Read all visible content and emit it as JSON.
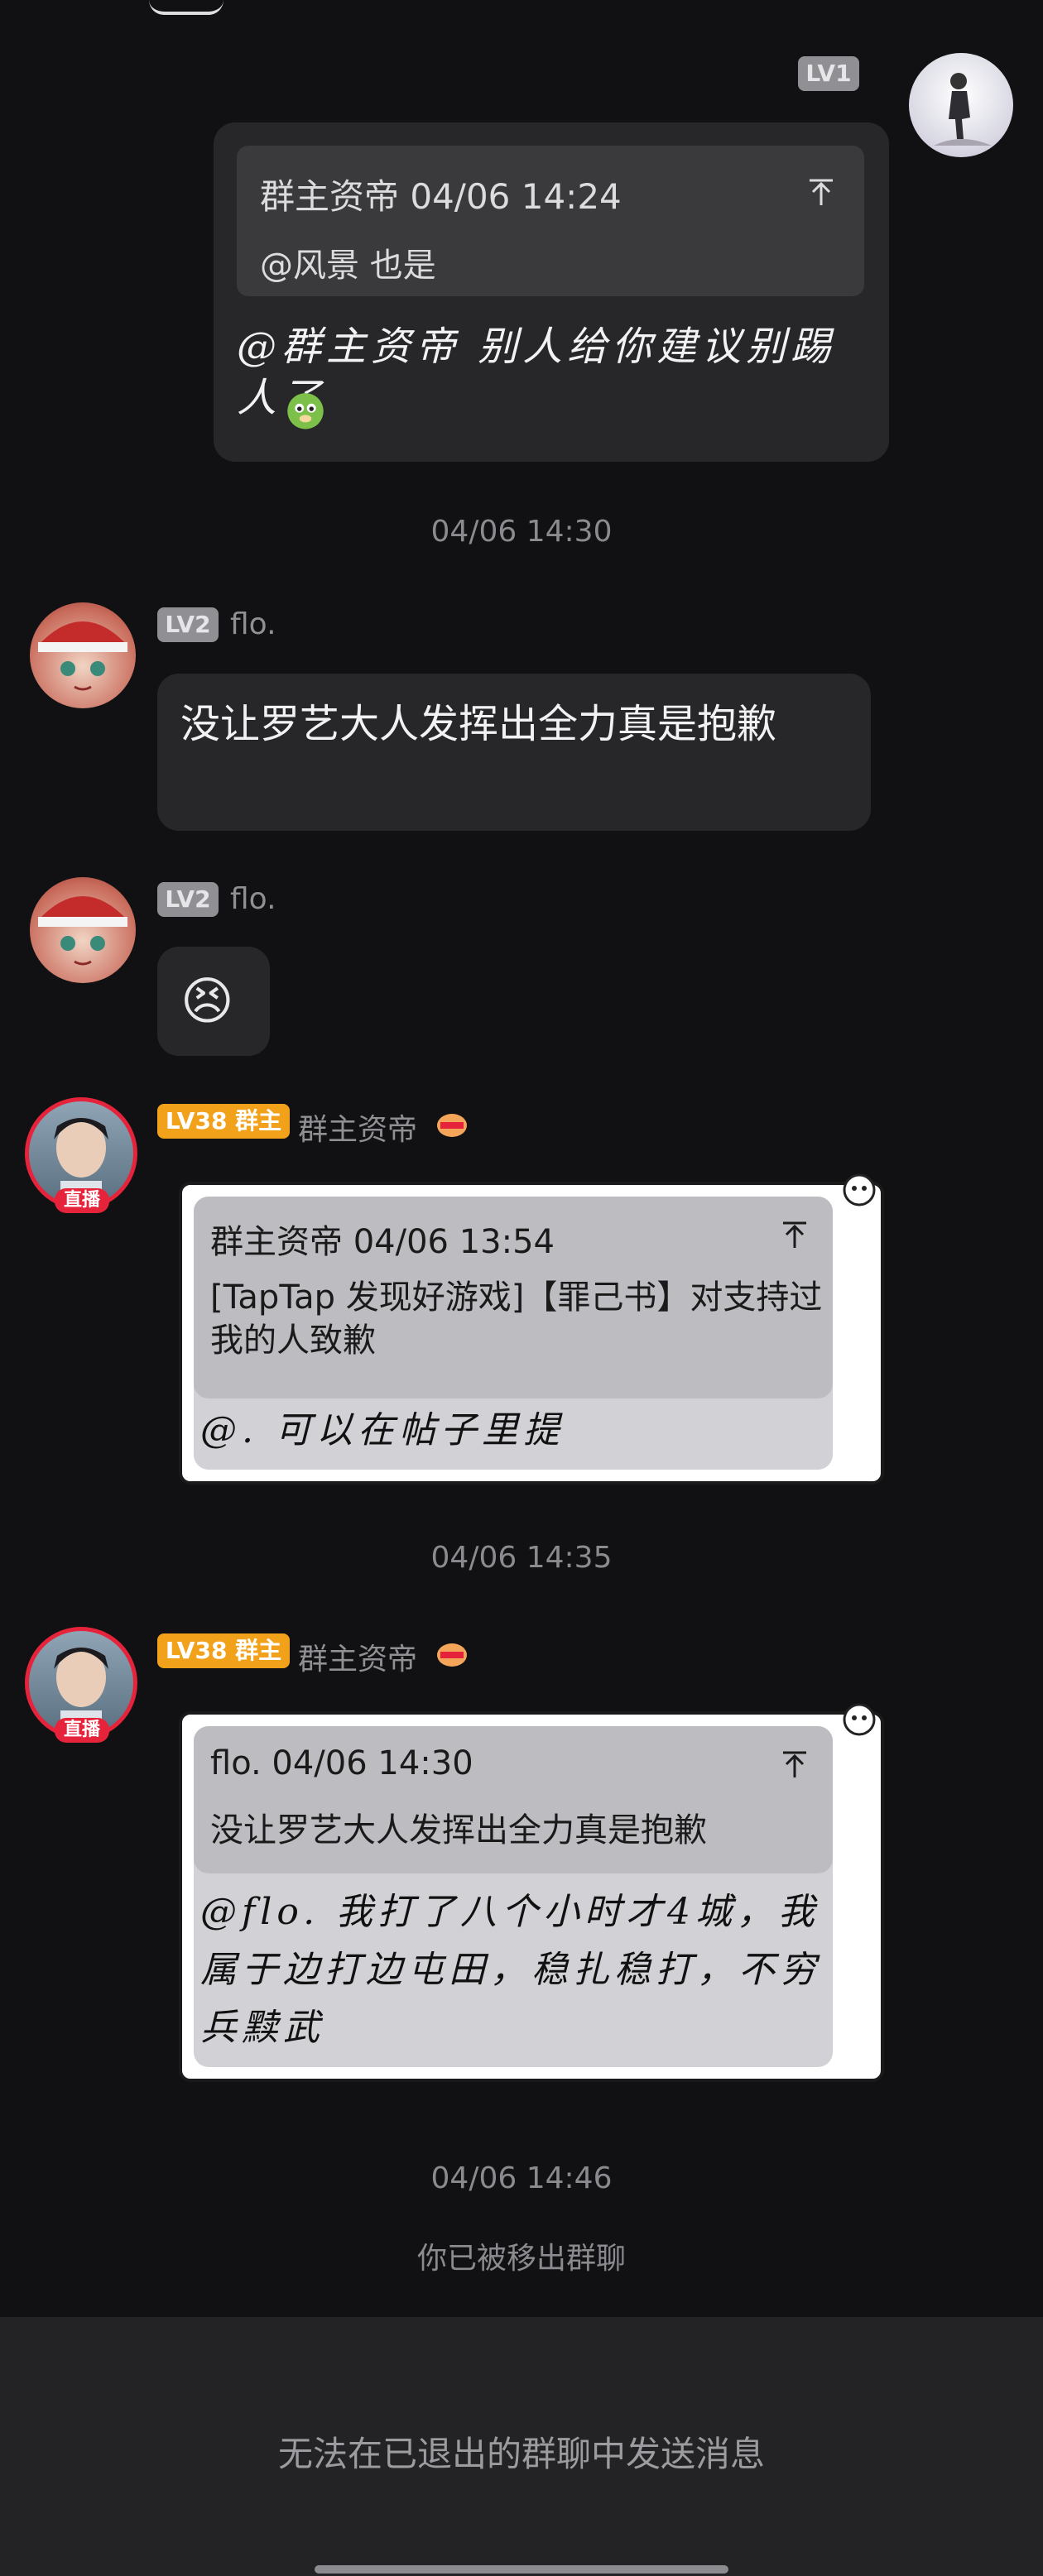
{
  "messages": {
    "m1": {
      "level": "LV1",
      "quote_header": "群主资帝 04/06 14:24",
      "quote_body": "@风景 也是",
      "text": "@群主资帝 别人给你建议别踢人了"
    },
    "time1": "04/06 14:30",
    "m2": {
      "level": "LV2",
      "name": "flo.",
      "text": "没让罗艺大人发挥出全力真是抱歉"
    },
    "m3": {
      "level": "LV2",
      "name": "flo.",
      "emoji": "😣"
    },
    "m4": {
      "level": "LV38 群主",
      "name": "群主资帝",
      "live": "直播",
      "quote_header": "群主资帝 04/06 13:54",
      "quote_body": "[TapTap 发现好游戏]【罪己书】对支持过我的人致歉",
      "text": "@. 可以在帖子里提"
    },
    "time2": "04/06 14:35",
    "m5": {
      "level": "LV38 群主",
      "name": "群主资帝",
      "live": "直播",
      "quote_header": "flo. 04/06 14:30",
      "quote_body": "没让罗艺大人发挥出全力真是抱歉",
      "text": "@flo. 我打了八个小时才4城，我属于边打边屯田，稳扎稳打，不穷兵黩武"
    },
    "time3": "04/06 14:46",
    "system_notice": "你已被移出群聊"
  },
  "footer": {
    "notice": "无法在已退出的群聊中发送消息"
  },
  "colors": {
    "background": "#111113",
    "bubble": "#27272a",
    "owner_badge": "#f2a21a",
    "live_badge": "#e5243b"
  },
  "icons": [
    "pin-top-icon",
    "dragon-sticker-icon",
    "red-envelope-icon",
    "crying-emoji"
  ]
}
